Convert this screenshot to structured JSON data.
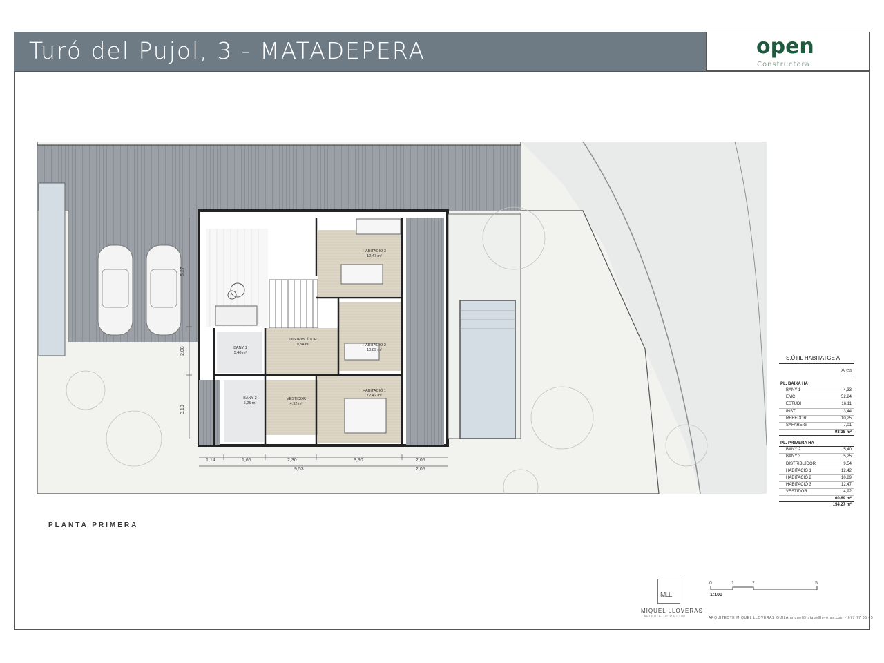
{
  "header": {
    "title": "Turó del Pujol, 3  - MATADEPERA",
    "logo_main": "open",
    "logo_sub": "Constructora"
  },
  "plan": {
    "label": "PLANTA PRIMERA",
    "rooms": {
      "habitacio3": {
        "name": "HABITACIÓ 3",
        "area": "12,47 m²"
      },
      "distribuidor": {
        "name": "DISTRIBUÏDOR",
        "area": "9,54 m²"
      },
      "bany1": {
        "name": "BANY 1",
        "area": "5,40 m²"
      },
      "habitacio2": {
        "name": "HABITACIÓ 2",
        "area": "10,89 m²"
      },
      "bany2": {
        "name": "BANY 2",
        "area": "5,25 m²"
      },
      "vestidor": {
        "name": "VESTIDOR",
        "area": "4,92 m²"
      },
      "habitacio1": {
        "name": "HABITACIÓ 1",
        "area": "12,42 m²"
      }
    },
    "dimensions": {
      "v1": "5,27",
      "v2": "2,08",
      "v3": "3,19",
      "h1": "1,14",
      "h2": "1,65",
      "h3": "2,30",
      "h4": "3,90",
      "h5": "2,05",
      "total": "9,53",
      "total2": "2,05"
    }
  },
  "area_table": {
    "title": "S.ÚTIL HABITATGE A",
    "col": "Àrea",
    "sections": [
      {
        "name": "PL. BAIXA HA",
        "rows": [
          {
            "room": "BANY 1",
            "area": "4,33"
          },
          {
            "room": "EMC",
            "area": "52,24"
          },
          {
            "room": "ESTUDI",
            "area": "16,11"
          },
          {
            "room": "INST.",
            "area": "3,44"
          },
          {
            "room": "REBEDOR",
            "area": "10,25"
          },
          {
            "room": "SAFAREIG",
            "area": "7,01"
          }
        ],
        "total": "93,38 m²"
      },
      {
        "name": "PL. PRIMERA HA",
        "rows": [
          {
            "room": "BANY 2",
            "area": "5,40"
          },
          {
            "room": "BANY 3",
            "area": "5,25"
          },
          {
            "room": "DISTRIBUÏDOR",
            "area": "9,54"
          },
          {
            "room": "HABITACIÓ 1",
            "area": "12,42"
          },
          {
            "room": "HABITACIÓ 2",
            "area": "10,89"
          },
          {
            "room": "HABITACIÓ 3",
            "area": "12,47"
          },
          {
            "room": "VESTIDOR",
            "area": "4,92"
          }
        ],
        "total": "60,89 m²"
      }
    ],
    "grand_total": "154,27 m²"
  },
  "architect": {
    "logo": "MLL",
    "name": "MIQUEL LLOVERAS",
    "web": "ARQUITECTURA.COM"
  },
  "scale": {
    "ticks": [
      "0",
      "1",
      "2",
      "5"
    ],
    "label": "1:100"
  },
  "footer": "ARQUITECTE  MIQUEL LLOVERAS GUILÀ   miquel@miquellloveras.com · 677 77 05 05"
}
